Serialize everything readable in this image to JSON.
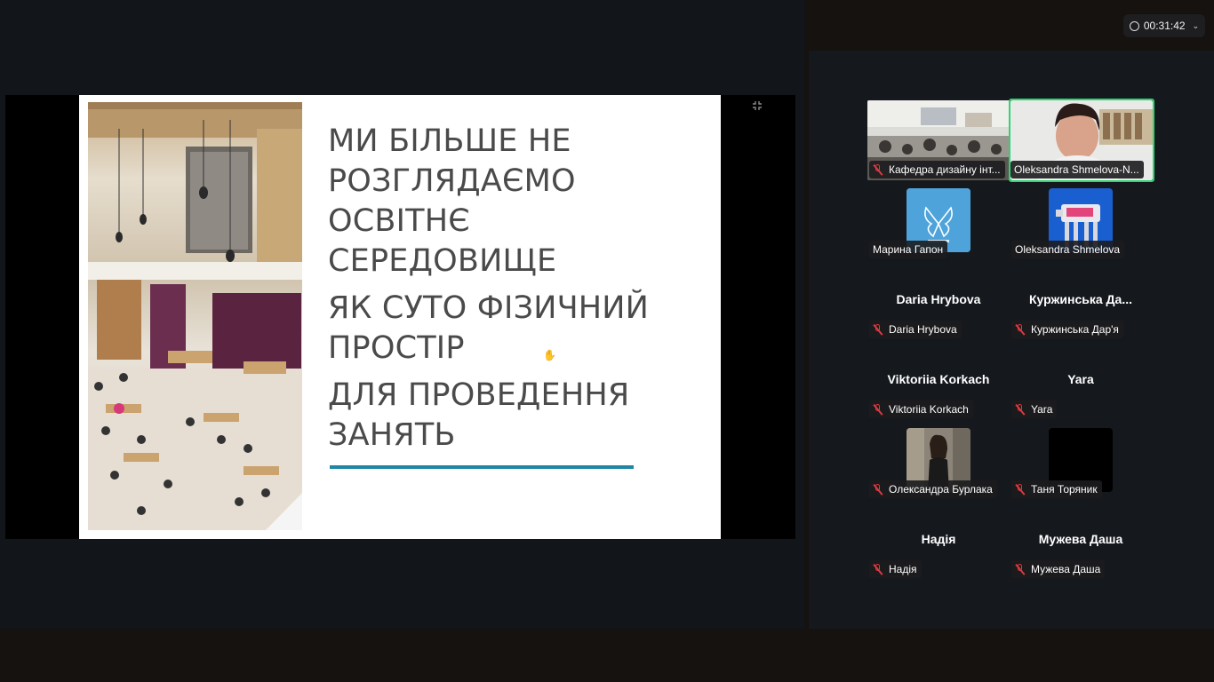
{
  "meeting": {
    "elapsed_time": "00:31:42"
  },
  "slide": {
    "line_groups": [
      [
        "МИ БІЛЬШЕ НЕ",
        "РОЗГЛЯДАЄМО",
        "ОСВІТНЄ",
        "СЕРЕДОВИЩЕ"
      ],
      [
        "ЯК СУТО ФІЗИЧНИЙ",
        "ПРОСТІР"
      ],
      [
        "ДЛЯ ПРОВЕДЕННЯ",
        "ЗАНЯТЬ"
      ]
    ],
    "accent_color": "#1f86a3"
  },
  "participants": [
    {
      "display": "video",
      "label": "Кафедра дизайну інт...",
      "muted": true,
      "active": false
    },
    {
      "display": "video",
      "label": "Oleksandra Shmelova-N...",
      "muted": false,
      "active": true
    },
    {
      "display": "avatar",
      "label": "Марина Гапон",
      "muted": false
    },
    {
      "display": "avatar",
      "label": "Oleksandra Shmelova",
      "muted": false
    },
    {
      "display": "name",
      "name": "Daria Hrybova",
      "label": "Daria Hrybova",
      "muted": true
    },
    {
      "display": "name",
      "name": "Куржинська  Да...",
      "label": "Куржинська Дар'я",
      "muted": true
    },
    {
      "display": "name",
      "name": "Viktoriia Korkach",
      "label": "Viktoriia Korkach",
      "muted": true
    },
    {
      "display": "name",
      "name": "Yara",
      "label": "Yara",
      "muted": true
    },
    {
      "display": "avatar",
      "label": "Олександра Бурлака",
      "muted": true
    },
    {
      "display": "avatar",
      "label": "Таня Торяник",
      "muted": true
    },
    {
      "display": "name",
      "name": "Надія",
      "label": "Надія",
      "muted": true
    },
    {
      "display": "name",
      "name": "Мужева Даша",
      "label": "Мужева Даша",
      "muted": true
    }
  ],
  "colors": {
    "active_speaker": "#2ed573",
    "muted_mic": "#e0383e"
  }
}
